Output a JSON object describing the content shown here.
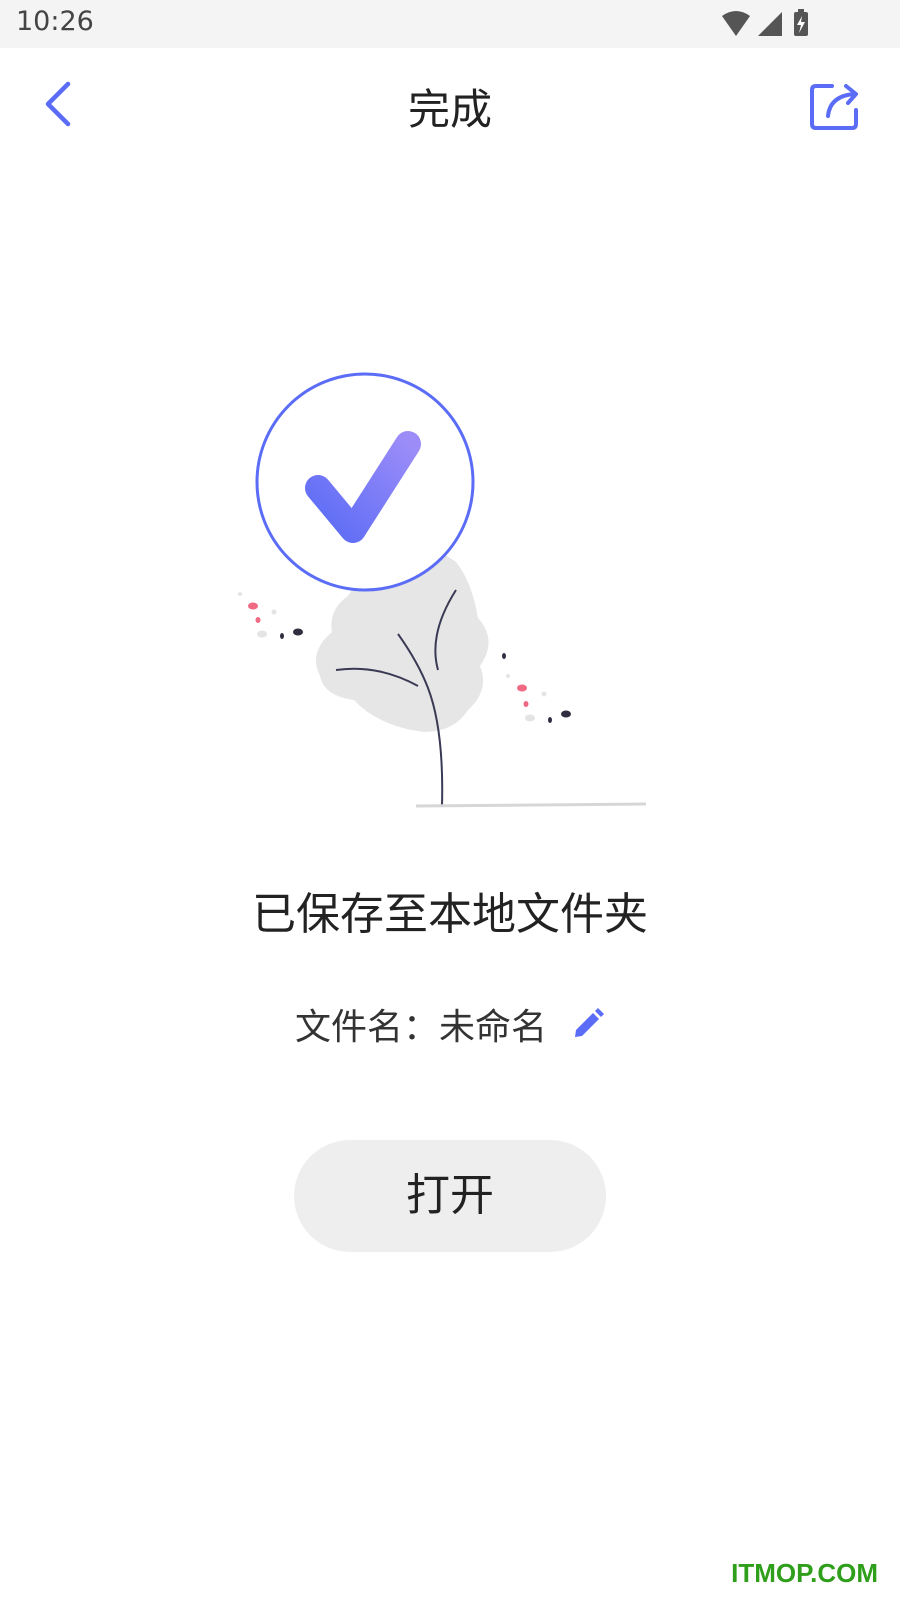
{
  "status_bar": {
    "time": "10:26",
    "icons": [
      "wifi-icon",
      "signal-icon",
      "battery-charging-icon"
    ]
  },
  "app_bar": {
    "title": "完成",
    "back_icon": "chevron-left-icon",
    "share_icon": "share-icon"
  },
  "main": {
    "saved_message": "已保存至本地文件夹",
    "filename_label": "文件名：",
    "filename_value": "未命名",
    "edit_icon": "pencil-icon",
    "open_button_label": "打开"
  },
  "watermark": "ITMOP.COM",
  "colors": {
    "accent": "#5b6cf6",
    "check_gradient_end": "#9b8cf8",
    "text_primary": "#222222",
    "button_bg": "#eeeeee",
    "watermark": "#2f9e1a"
  }
}
